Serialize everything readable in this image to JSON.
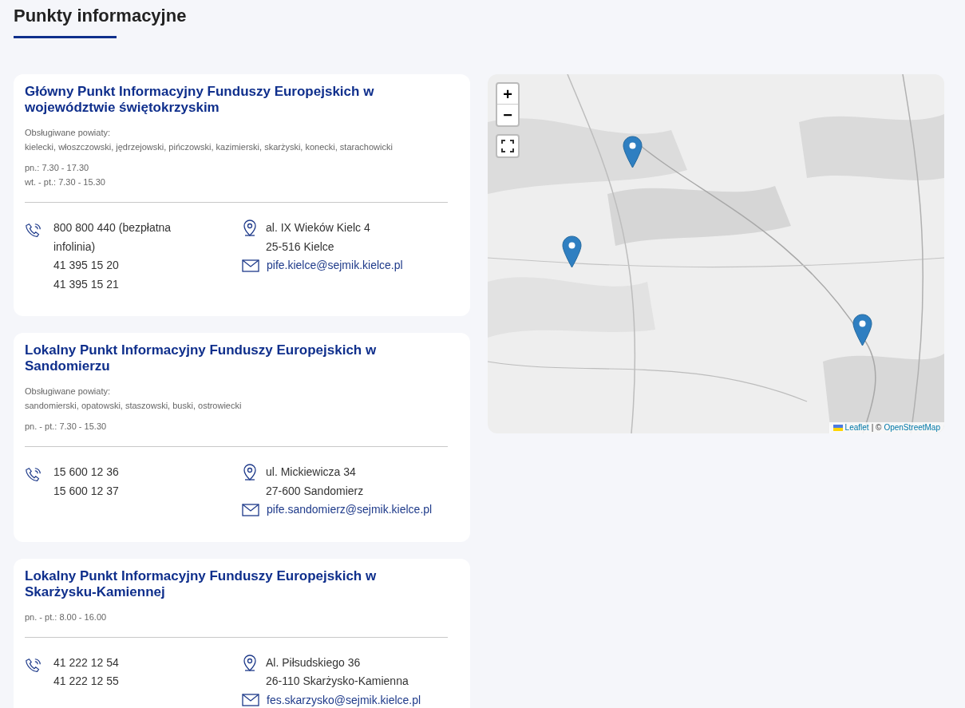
{
  "title": "Punkty informacyjne",
  "points": [
    {
      "name": "Główny Punkt Informacyjny Funduszy Europejskich w województwie świętokrzyskim",
      "districts_label": "Obsługiwane powiaty:",
      "districts": "kielecki, włoszczowski, jędrzejowski, pińczowski, kazimierski, skarżyski, konecki, starachowicki",
      "hours": [
        "pn.: 7.30 - 17.30",
        "wt. - pt.: 7.30 - 15.30"
      ],
      "phones": [
        "800 800 440 (bezpłatna infolinia)",
        "41 395 15 20",
        "41 395 15 21"
      ],
      "address": [
        "al. IX Wieków Kielc 4",
        "25-516 Kielce"
      ],
      "email": "pife.kielce@sejmik.kielce.pl"
    },
    {
      "name": "Lokalny Punkt Informacyjny Funduszy Europejskich w Sandomierzu",
      "districts_label": "Obsługiwane powiaty:",
      "districts": "sandomierski, opatowski, staszowski, buski, ostrowiecki",
      "hours": [
        "pn. - pt.: 7.30 - 15.30"
      ],
      "phones": [
        "15 600 12 36",
        "15 600 12 37"
      ],
      "address": [
        "ul. Mickiewicza 34",
        "27-600 Sandomierz"
      ],
      "email": "pife.sandomierz@sejmik.kielce.pl"
    },
    {
      "name": "Lokalny Punkt Informacyjny Funduszy Europejskich w Skarżysku-Kamiennej",
      "hours": [
        "pn. - pt.: 8.00 - 16.00"
      ],
      "phones": [
        "41 222 12 54",
        "41 222 12 55"
      ],
      "address": [
        "Al. Piłsudskiego 36",
        "26-110 Skarżysko-Kamienna"
      ],
      "email": "fes.skarzysko@sejmik.kielce.pl"
    }
  ],
  "map": {
    "zoom_in": "+",
    "zoom_out": "−",
    "attribution_link": "Leaflet",
    "attribution_separator": "| ©",
    "attribution_source": "OpenStreetMap"
  }
}
